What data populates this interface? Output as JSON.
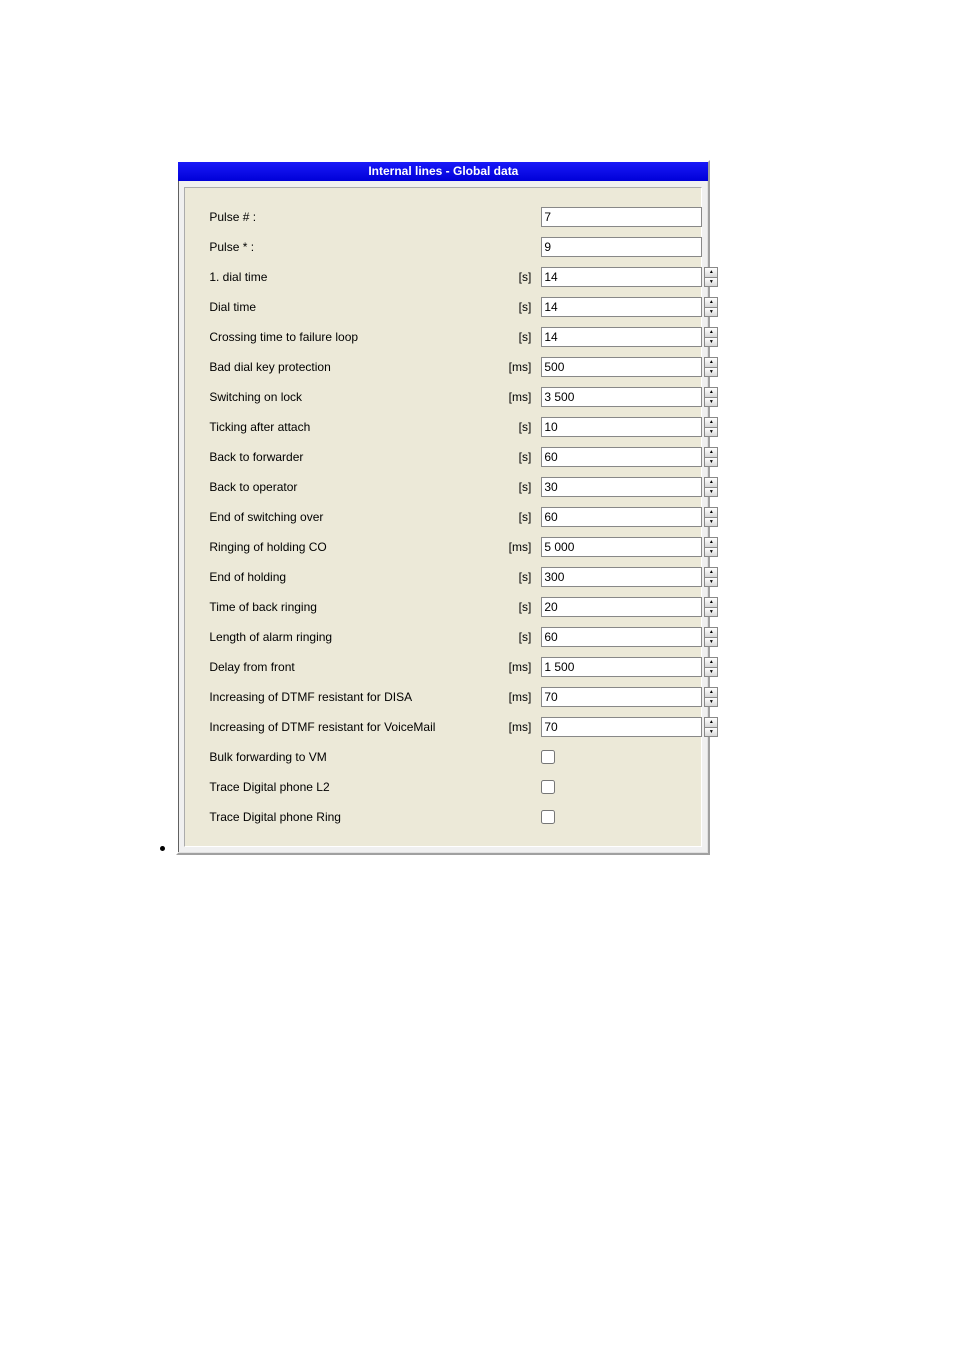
{
  "title": "Internal lines - Global data",
  "rows": [
    {
      "label": "Pulse # :",
      "unit": "",
      "value": "7",
      "kind": "text"
    },
    {
      "label": "Pulse * :",
      "unit": "",
      "value": "9",
      "kind": "text"
    },
    {
      "label": "1. dial time",
      "unit": "[s]",
      "value": "14",
      "kind": "spin"
    },
    {
      "label": "Dial time",
      "unit": "[s]",
      "value": "14",
      "kind": "spin"
    },
    {
      "label": "Crossing time to failure loop",
      "unit": "[s]",
      "value": "14",
      "kind": "spin"
    },
    {
      "label": "Bad dial key protection",
      "unit": "[ms]",
      "value": "500",
      "kind": "spin"
    },
    {
      "label": "Switching on lock",
      "unit": "[ms]",
      "value": "3 500",
      "kind": "spin"
    },
    {
      "label": "Ticking after attach",
      "unit": "[s]",
      "value": "10",
      "kind": "spin"
    },
    {
      "label": "Back to forwarder",
      "unit": "[s]",
      "value": "60",
      "kind": "spin"
    },
    {
      "label": "Back to operator",
      "unit": "[s]",
      "value": "30",
      "kind": "spin"
    },
    {
      "label": "End of switching over",
      "unit": "[s]",
      "value": "60",
      "kind": "spin"
    },
    {
      "label": "Ringing of holding CO",
      "unit": "[ms]",
      "value": "5 000",
      "kind": "spin"
    },
    {
      "label": "End of holding",
      "unit": "[s]",
      "value": "300",
      "kind": "spin"
    },
    {
      "label": "Time of back ringing",
      "unit": "[s]",
      "value": "20",
      "kind": "spin"
    },
    {
      "label": "Length of alarm ringing",
      "unit": "[s]",
      "value": "60",
      "kind": "spin"
    },
    {
      "label": "Delay from front",
      "unit": "[ms]",
      "value": "1 500",
      "kind": "spin"
    },
    {
      "label": "Increasing of DTMF resistant for DISA",
      "unit": "[ms]",
      "value": "70",
      "kind": "spin"
    },
    {
      "label": "Increasing of DTMF resistant for VoiceMail",
      "unit": "[ms]",
      "value": "70",
      "kind": "spin"
    },
    {
      "label": "Bulk forwarding to VM",
      "unit": "",
      "checked": false,
      "kind": "check"
    },
    {
      "label": "Trace Digital phone L2",
      "unit": "",
      "checked": false,
      "kind": "check"
    },
    {
      "label": "Trace Digital phone Ring",
      "unit": "",
      "checked": false,
      "kind": "check"
    }
  ]
}
